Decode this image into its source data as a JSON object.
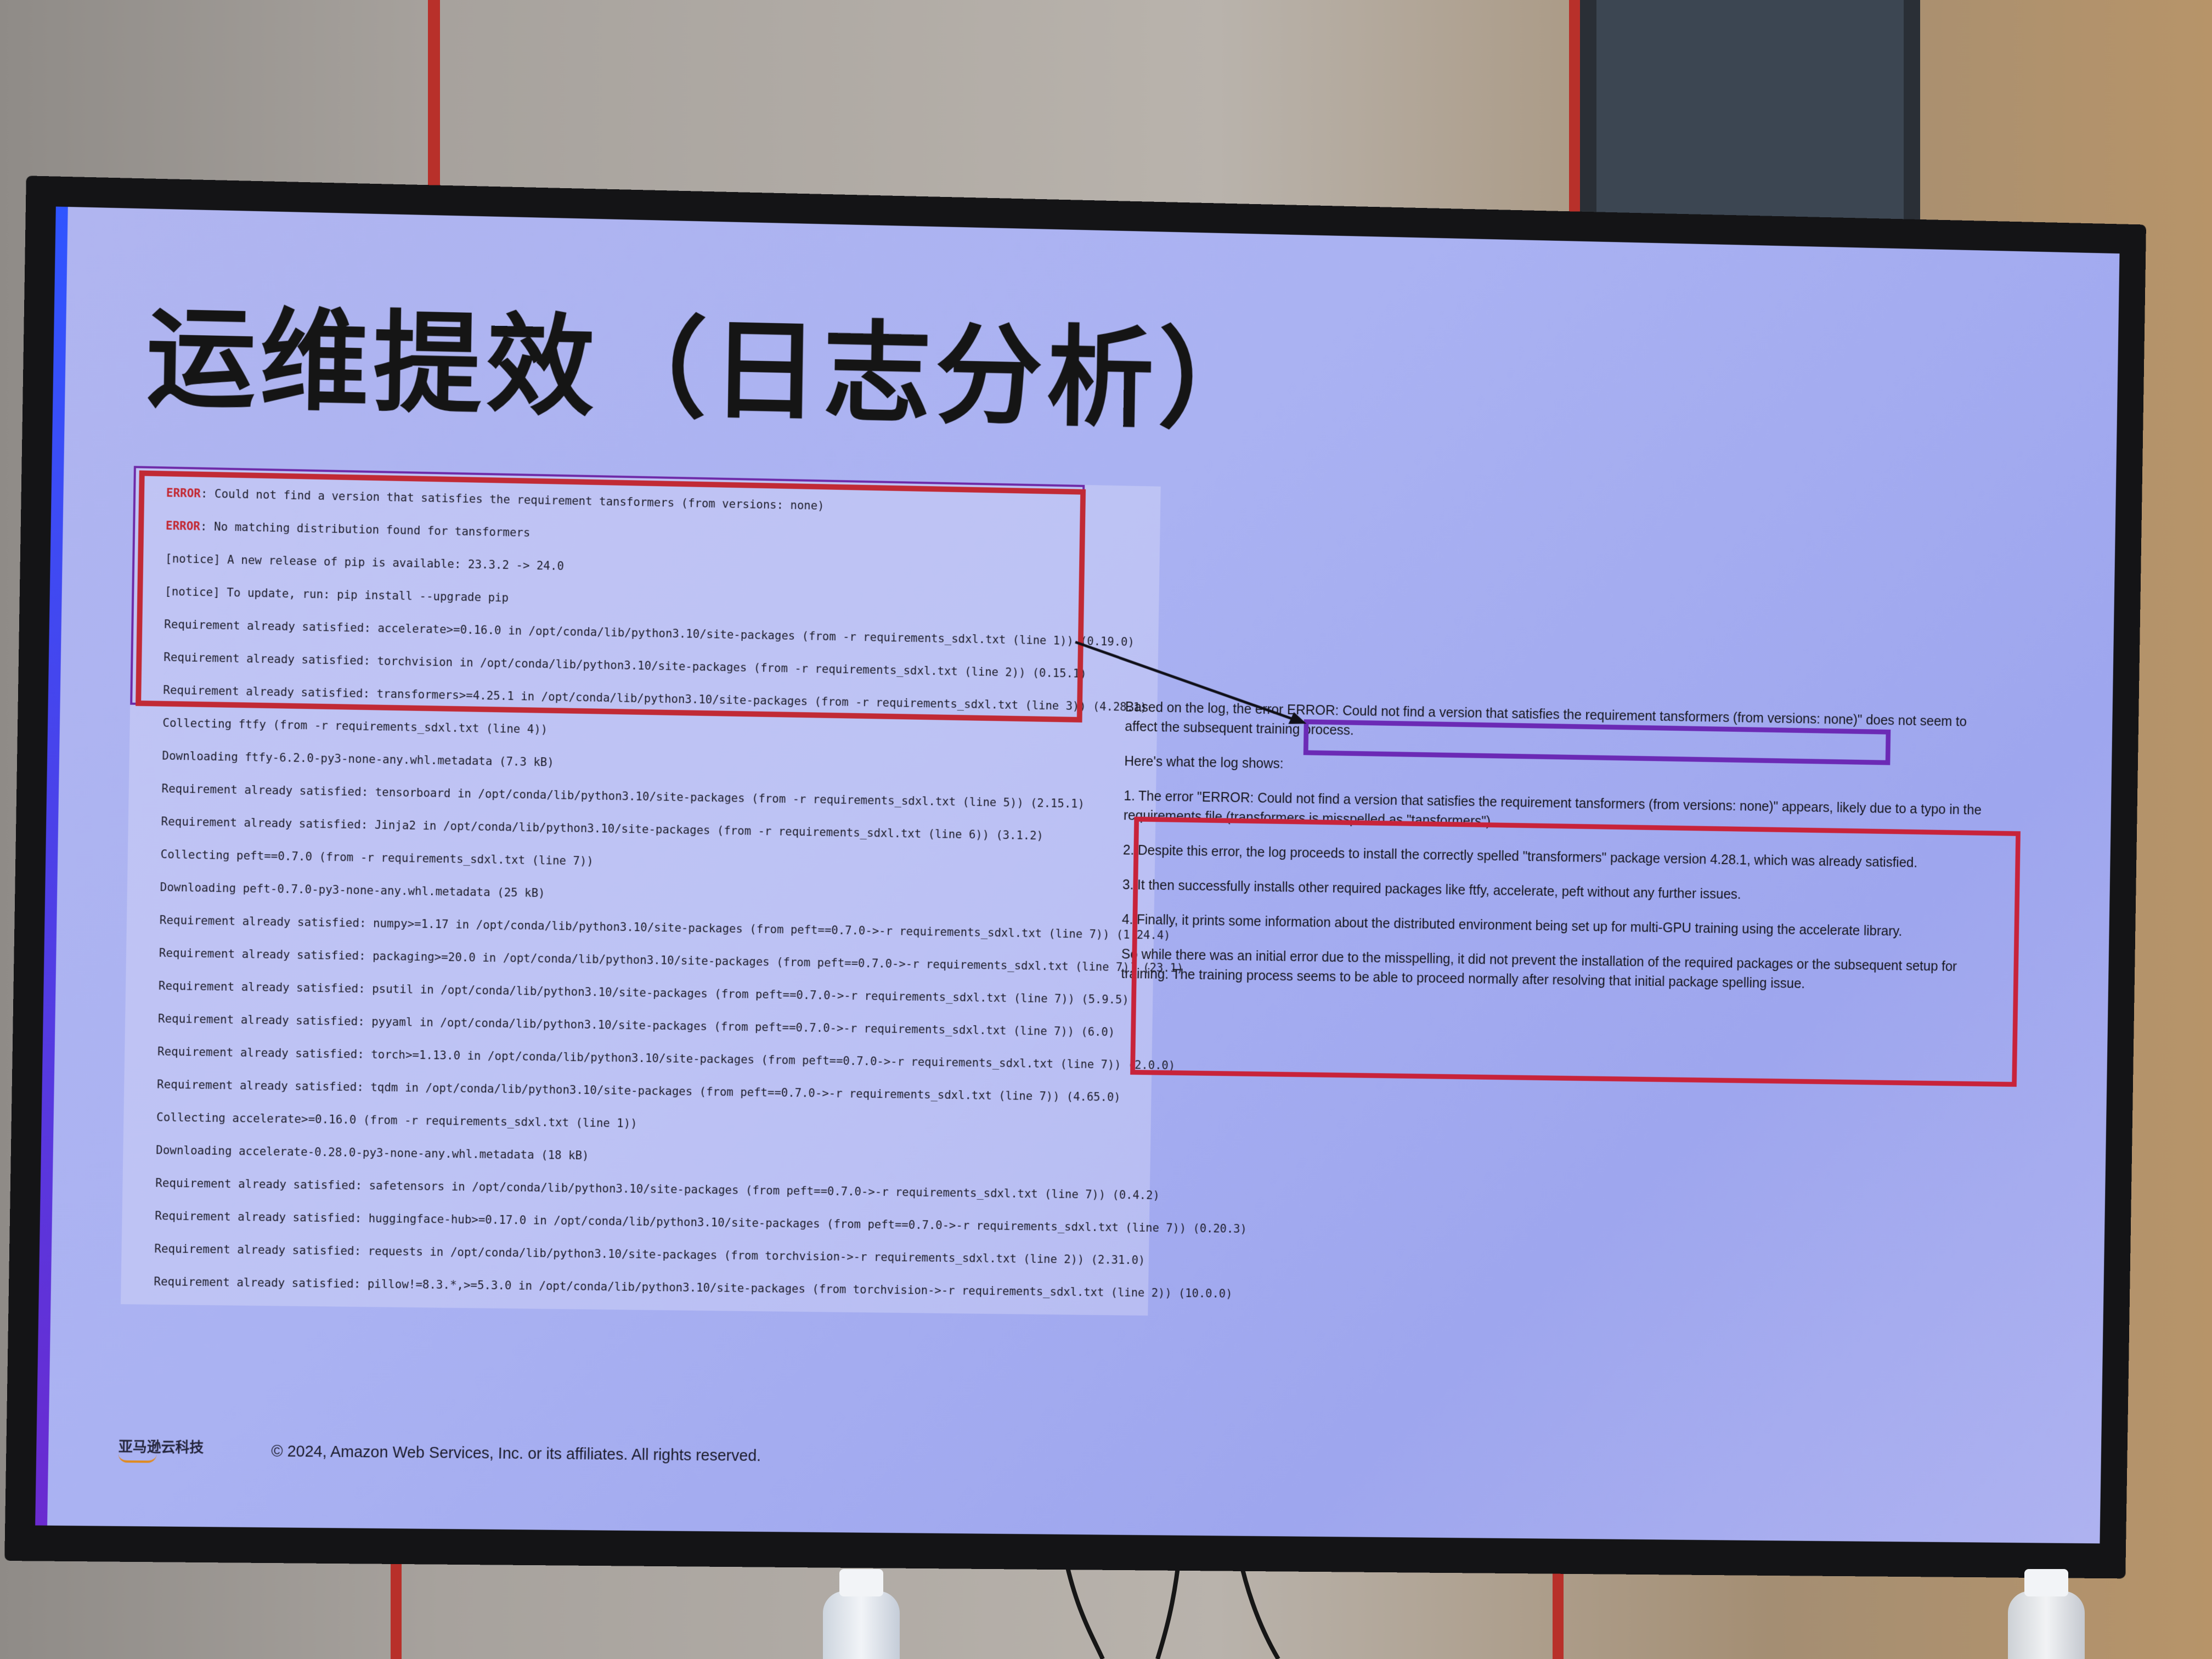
{
  "slide": {
    "title": "运维提效（日志分析）",
    "log_lines": [
      {
        "level": "ERROR",
        "text": ": Could not find a version that satisfies the requirement tansformers (from versions: none)"
      },
      {
        "level": "ERROR",
        "text": ": No matching distribution found for tansformers"
      },
      {
        "level": "",
        "text": "[notice] A new release of pip is available: 23.3.2 -> 24.0"
      },
      {
        "level": "",
        "text": "[notice] To update, run: pip install --upgrade pip"
      },
      {
        "level": "",
        "text": "Requirement already satisfied: accelerate>=0.16.0 in /opt/conda/lib/python3.10/site-packages (from -r requirements_sdxl.txt (line 1)) (0.19.0)"
      },
      {
        "level": "",
        "text": "Requirement already satisfied: torchvision in /opt/conda/lib/python3.10/site-packages (from -r requirements_sdxl.txt (line 2)) (0.15.1)"
      },
      {
        "level": "",
        "text": "Requirement already satisfied: transformers>=4.25.1 in /opt/conda/lib/python3.10/site-packages (from -r requirements_sdxl.txt (line 3)) (4.28.1)"
      },
      {
        "level": "",
        "text": "Collecting ftfy (from -r requirements_sdxl.txt (line 4))"
      },
      {
        "level": "",
        "text": "Downloading ftfy-6.2.0-py3-none-any.whl.metadata (7.3 kB)"
      },
      {
        "level": "",
        "text": "Requirement already satisfied: tensorboard in /opt/conda/lib/python3.10/site-packages (from -r requirements_sdxl.txt (line 5)) (2.15.1)"
      },
      {
        "level": "",
        "text": "Requirement already satisfied: Jinja2 in /opt/conda/lib/python3.10/site-packages (from -r requirements_sdxl.txt (line 6)) (3.1.2)"
      },
      {
        "level": "",
        "text": "Collecting peft==0.7.0 (from -r requirements_sdxl.txt (line 7))"
      },
      {
        "level": "",
        "text": "Downloading peft-0.7.0-py3-none-any.whl.metadata (25 kB)"
      },
      {
        "level": "",
        "text": "Requirement already satisfied: numpy>=1.17 in /opt/conda/lib/python3.10/site-packages (from peft==0.7.0->-r requirements_sdxl.txt (line 7)) (1.24.4)"
      },
      {
        "level": "",
        "text": "Requirement already satisfied: packaging>=20.0 in /opt/conda/lib/python3.10/site-packages (from peft==0.7.0->-r requirements_sdxl.txt (line 7)) (23.1)"
      },
      {
        "level": "",
        "text": "Requirement already satisfied: psutil in /opt/conda/lib/python3.10/site-packages (from peft==0.7.0->-r requirements_sdxl.txt (line 7)) (5.9.5)"
      },
      {
        "level": "",
        "text": "Requirement already satisfied: pyyaml in /opt/conda/lib/python3.10/site-packages (from peft==0.7.0->-r requirements_sdxl.txt (line 7)) (6.0)"
      },
      {
        "level": "",
        "text": "Requirement already satisfied: torch>=1.13.0 in /opt/conda/lib/python3.10/site-packages (from peft==0.7.0->-r requirements_sdxl.txt (line 7)) (2.0.0)"
      },
      {
        "level": "",
        "text": "Requirement already satisfied: tqdm in /opt/conda/lib/python3.10/site-packages (from peft==0.7.0->-r requirements_sdxl.txt (line 7)) (4.65.0)"
      },
      {
        "level": "",
        "text": "Collecting accelerate>=0.16.0 (from -r requirements_sdxl.txt (line 1))"
      },
      {
        "level": "",
        "text": "Downloading accelerate-0.28.0-py3-none-any.whl.metadata (18 kB)"
      },
      {
        "level": "",
        "text": "Requirement already satisfied: safetensors in /opt/conda/lib/python3.10/site-packages (from peft==0.7.0->-r requirements_sdxl.txt (line 7)) (0.4.2)"
      },
      {
        "level": "",
        "text": "Requirement already satisfied: huggingface-hub>=0.17.0 in /opt/conda/lib/python3.10/site-packages (from peft==0.7.0->-r requirements_sdxl.txt (line 7)) (0.20.3)"
      },
      {
        "level": "",
        "text": "Requirement already satisfied: requests in /opt/conda/lib/python3.10/site-packages (from torchvision->-r requirements_sdxl.txt (line 2)) (2.31.0)"
      },
      {
        "level": "",
        "text": "Requirement already satisfied: pillow!=8.3.*,>=5.3.0 in /opt/conda/lib/python3.10/site-packages (from torchvision->-r requirements_sdxl.txt (line 2)) (10.0.0)"
      }
    ],
    "analysis": {
      "intro_before": "Based on the log, the error ",
      "intro_error": "ERROR: Could not find a version that satisfies the requirement tansformers (from versions: none)",
      "intro_after": "\" does not seem to affect the subsequent training process.",
      "heading": "Here's what the log shows:",
      "points": [
        "1. The error \"ERROR: Could not find a version that satisfies the requirement tansformers (from versions: none)\" appears, likely due to a typo in the requirements file (transformers is misspelled as \"tansformers\").",
        "2. Despite this error, the log proceeds to install the correctly spelled \"transformers\" package version 4.28.1, which was already satisfied.",
        "3. It then successfully installs other required packages like ftfy, accelerate, peft without any further issues.",
        "4. Finally, it prints some information about the distributed environment being set up for multi-GPU training using the accelerate library."
      ],
      "conclusion": "So while there was an initial error due to the misspelling, it did not prevent the installation of the required packages or the subsequent setup for training. The training process seems to be able to proceed normally after resolving that initial package spelling issue."
    },
    "footer": {
      "logo_text": "亚马逊云科技",
      "copyright": "© 2024, Amazon Web Services, Inc. or its affiliates. All rights reserved."
    },
    "colors": {
      "highlight_red": "#c8233a",
      "highlight_purple": "#6b2ab5",
      "slide_background": "#aab2f2"
    }
  }
}
